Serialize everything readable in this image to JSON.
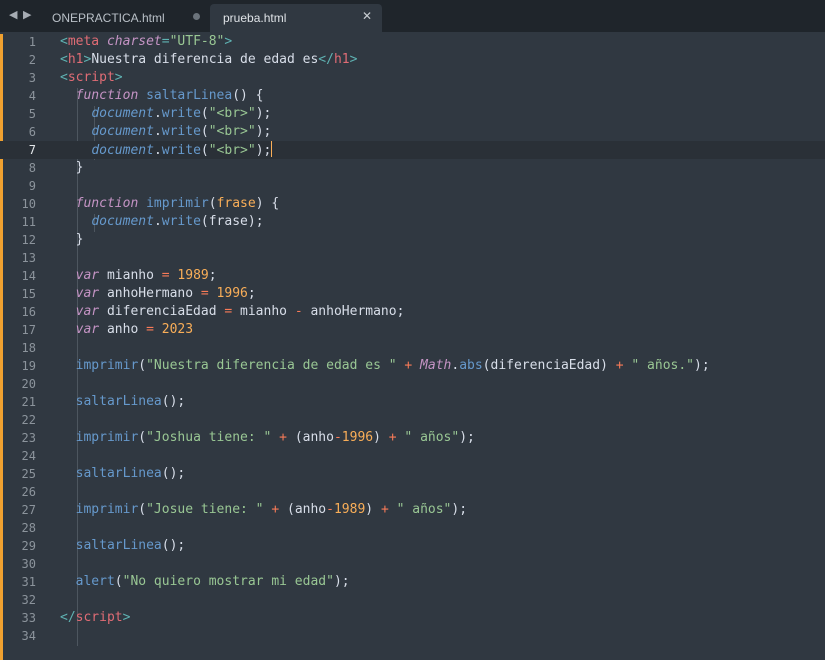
{
  "tabs": [
    {
      "label": "ONEPRACTICA.html",
      "active": false,
      "dirty": true
    },
    {
      "label": "prueba.html",
      "active": true,
      "dirty": false
    }
  ],
  "editor": {
    "current_line": 7,
    "lines": [
      {
        "n": "1",
        "tokens": [
          [
            "pu",
            "<"
          ],
          [
            "tag",
            "meta"
          ],
          [
            "pl",
            " "
          ],
          [
            "attr",
            "charset"
          ],
          [
            "pu",
            "="
          ],
          [
            "str",
            "\"UTF-8\""
          ],
          [
            "pu",
            ">"
          ]
        ]
      },
      {
        "n": "2",
        "tokens": [
          [
            "pu",
            "<"
          ],
          [
            "tag",
            "h1"
          ],
          [
            "pu",
            ">"
          ],
          [
            "pl",
            "Nuestra diferencia de edad es"
          ],
          [
            "pu",
            "</"
          ],
          [
            "tag",
            "h1"
          ],
          [
            "pu",
            ">"
          ]
        ]
      },
      {
        "n": "3",
        "tokens": [
          [
            "pu",
            "<"
          ],
          [
            "tag",
            "script"
          ],
          [
            "pu",
            ">"
          ]
        ]
      },
      {
        "n": "4",
        "tokens": [
          [
            "pl",
            "  "
          ],
          [
            "kw",
            "function"
          ],
          [
            "pl",
            " "
          ],
          [
            "fn",
            "saltarLinea"
          ],
          [
            "pl",
            "() {"
          ]
        ]
      },
      {
        "n": "5",
        "tokens": [
          [
            "pl",
            "    "
          ],
          [
            "obj",
            "document"
          ],
          [
            "pl",
            "."
          ],
          [
            "fn",
            "write"
          ],
          [
            "pl",
            "("
          ],
          [
            "str",
            "\"<br>\""
          ],
          [
            "pl",
            ");"
          ]
        ]
      },
      {
        "n": "6",
        "tokens": [
          [
            "pl",
            "    "
          ],
          [
            "obj",
            "document"
          ],
          [
            "pl",
            "."
          ],
          [
            "fn",
            "write"
          ],
          [
            "pl",
            "("
          ],
          [
            "str",
            "\"<br>\""
          ],
          [
            "pl",
            ");"
          ]
        ]
      },
      {
        "n": "7",
        "tokens": [
          [
            "pl",
            "    "
          ],
          [
            "obj",
            "document"
          ],
          [
            "pl",
            "."
          ],
          [
            "fn",
            "write"
          ],
          [
            "pl",
            "("
          ],
          [
            "str",
            "\"<br>\""
          ],
          [
            "pl",
            ");"
          ]
        ]
      },
      {
        "n": "8",
        "tokens": [
          [
            "pl",
            "  }"
          ]
        ]
      },
      {
        "n": "9",
        "tokens": []
      },
      {
        "n": "10",
        "tokens": [
          [
            "pl",
            "  "
          ],
          [
            "kw",
            "function"
          ],
          [
            "pl",
            " "
          ],
          [
            "fn",
            "imprimir"
          ],
          [
            "pl",
            "("
          ],
          [
            "par",
            "frase"
          ],
          [
            "pl",
            ") {"
          ]
        ]
      },
      {
        "n": "11",
        "tokens": [
          [
            "pl",
            "    "
          ],
          [
            "obj",
            "document"
          ],
          [
            "pl",
            "."
          ],
          [
            "fn",
            "write"
          ],
          [
            "pl",
            "(frase);"
          ]
        ]
      },
      {
        "n": "12",
        "tokens": [
          [
            "pl",
            "  }"
          ]
        ]
      },
      {
        "n": "13",
        "tokens": []
      },
      {
        "n": "14",
        "tokens": [
          [
            "pl",
            "  "
          ],
          [
            "kw",
            "var"
          ],
          [
            "pl",
            " mianho "
          ],
          [
            "op",
            "="
          ],
          [
            "pl",
            " "
          ],
          [
            "num",
            "1989"
          ],
          [
            "pl",
            ";"
          ]
        ]
      },
      {
        "n": "15",
        "tokens": [
          [
            "pl",
            "  "
          ],
          [
            "kw",
            "var"
          ],
          [
            "pl",
            " anhoHermano "
          ],
          [
            "op",
            "="
          ],
          [
            "pl",
            " "
          ],
          [
            "num",
            "1996"
          ],
          [
            "pl",
            ";"
          ]
        ]
      },
      {
        "n": "16",
        "tokens": [
          [
            "pl",
            "  "
          ],
          [
            "kw",
            "var"
          ],
          [
            "pl",
            " diferenciaEdad "
          ],
          [
            "op",
            "="
          ],
          [
            "pl",
            " mianho "
          ],
          [
            "op",
            "-"
          ],
          [
            "pl",
            " anhoHermano;"
          ]
        ]
      },
      {
        "n": "17",
        "tokens": [
          [
            "pl",
            "  "
          ],
          [
            "kw",
            "var"
          ],
          [
            "pl",
            " anho "
          ],
          [
            "op",
            "="
          ],
          [
            "pl",
            " "
          ],
          [
            "num",
            "2023"
          ]
        ]
      },
      {
        "n": "18",
        "tokens": []
      },
      {
        "n": "19",
        "tokens": [
          [
            "pl",
            "  "
          ],
          [
            "fn",
            "imprimir"
          ],
          [
            "pl",
            "("
          ],
          [
            "str",
            "\"Nuestra diferencia de edad es \""
          ],
          [
            "pl",
            " "
          ],
          [
            "op",
            "+"
          ],
          [
            "pl",
            " "
          ],
          [
            "cls",
            "Math"
          ],
          [
            "pl",
            "."
          ],
          [
            "fn",
            "abs"
          ],
          [
            "pl",
            "(diferenciaEdad) "
          ],
          [
            "op",
            "+"
          ],
          [
            "pl",
            " "
          ],
          [
            "str",
            "\" años.\""
          ],
          [
            "pl",
            ");"
          ]
        ]
      },
      {
        "n": "20",
        "tokens": []
      },
      {
        "n": "21",
        "tokens": [
          [
            "pl",
            "  "
          ],
          [
            "fn",
            "saltarLinea"
          ],
          [
            "pl",
            "();"
          ]
        ]
      },
      {
        "n": "22",
        "tokens": []
      },
      {
        "n": "23",
        "tokens": [
          [
            "pl",
            "  "
          ],
          [
            "fn",
            "imprimir"
          ],
          [
            "pl",
            "("
          ],
          [
            "str",
            "\"Joshua tiene: \""
          ],
          [
            "pl",
            " "
          ],
          [
            "op",
            "+"
          ],
          [
            "pl",
            " (anho"
          ],
          [
            "op",
            "-"
          ],
          [
            "num",
            "1996"
          ],
          [
            "pl",
            ") "
          ],
          [
            "op",
            "+"
          ],
          [
            "pl",
            " "
          ],
          [
            "str",
            "\" años\""
          ],
          [
            "pl",
            ");"
          ]
        ]
      },
      {
        "n": "24",
        "tokens": []
      },
      {
        "n": "25",
        "tokens": [
          [
            "pl",
            "  "
          ],
          [
            "fn",
            "saltarLinea"
          ],
          [
            "pl",
            "();"
          ]
        ]
      },
      {
        "n": "26",
        "tokens": []
      },
      {
        "n": "27",
        "tokens": [
          [
            "pl",
            "  "
          ],
          [
            "fn",
            "imprimir"
          ],
          [
            "pl",
            "("
          ],
          [
            "str",
            "\"Josue tiene: \""
          ],
          [
            "pl",
            " "
          ],
          [
            "op",
            "+"
          ],
          [
            "pl",
            " (anho"
          ],
          [
            "op",
            "-"
          ],
          [
            "num",
            "1989"
          ],
          [
            "pl",
            ") "
          ],
          [
            "op",
            "+"
          ],
          [
            "pl",
            " "
          ],
          [
            "str",
            "\" años\""
          ],
          [
            "pl",
            ");"
          ]
        ]
      },
      {
        "n": "28",
        "tokens": []
      },
      {
        "n": "29",
        "tokens": [
          [
            "pl",
            "  "
          ],
          [
            "fn",
            "saltarLinea"
          ],
          [
            "pl",
            "();"
          ]
        ]
      },
      {
        "n": "30",
        "tokens": []
      },
      {
        "n": "31",
        "tokens": [
          [
            "pl",
            "  "
          ],
          [
            "fn",
            "alert"
          ],
          [
            "pl",
            "("
          ],
          [
            "str",
            "\"No quiero mostrar mi edad\""
          ],
          [
            "pl",
            ");"
          ]
        ]
      },
      {
        "n": "32",
        "tokens": []
      },
      {
        "n": "33",
        "tokens": [
          [
            "pu",
            "</"
          ],
          [
            "tag",
            "script"
          ],
          [
            "pu",
            ">"
          ]
        ]
      },
      {
        "n": "34",
        "tokens": []
      }
    ]
  }
}
